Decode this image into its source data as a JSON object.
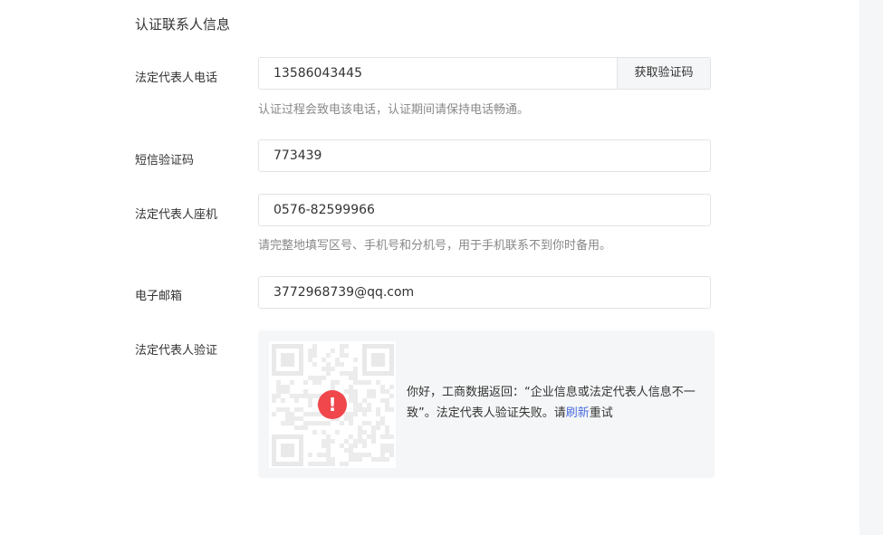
{
  "section": {
    "title": "认证联系人信息"
  },
  "phone": {
    "label": "法定代表人电话",
    "value": "13586043445",
    "button_label": "获取验证码",
    "hint": "认证过程会致电该电话，认证期间请保持电话畅通。"
  },
  "sms": {
    "label": "短信验证码",
    "value": "773439"
  },
  "landline": {
    "label": "法定代表人座机",
    "value": "0576-82599966",
    "hint": "请完整地填写区号、手机号和分机号，用于手机联系不到你时备用。"
  },
  "email": {
    "label": "电子邮箱",
    "value": "3772968739@qq.com"
  },
  "verification": {
    "label": "法定代表人验证",
    "message_before": "你好，工商数据返回：“企业信息或法定代表人信息不一致”。法定代表人验证失败。请",
    "refresh_label": "刷新",
    "message_after": "重试",
    "error_symbol": "!",
    "icons": [
      "qr-code-icon",
      "error-icon"
    ],
    "colors": {
      "error": "#f0474c",
      "link": "#4a6ee0"
    }
  }
}
